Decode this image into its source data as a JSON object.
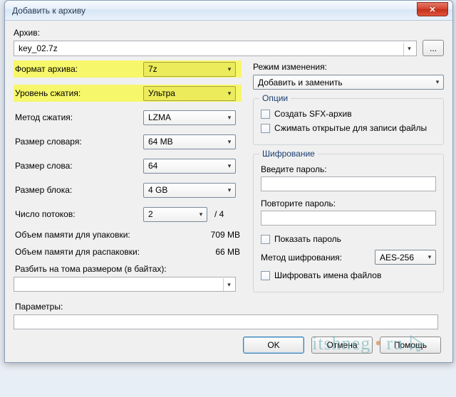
{
  "window": {
    "title": "Добавить к архиву"
  },
  "archive": {
    "label": "Архив:",
    "value": "key_02.7z",
    "browse": "..."
  },
  "left": {
    "format": {
      "label": "Формат архива:",
      "value": "7z"
    },
    "level": {
      "label": "Уровень сжатия:",
      "value": "Ультра"
    },
    "method": {
      "label": "Метод сжатия:",
      "value": "LZMA"
    },
    "dict": {
      "label": "Размер словаря:",
      "value": "64 MB"
    },
    "word": {
      "label": "Размер слова:",
      "value": "64"
    },
    "block": {
      "label": "Размер блока:",
      "value": "4 GB"
    },
    "threads": {
      "label": "Число потоков:",
      "value": "2",
      "max": "/ 4"
    },
    "mem_pack": {
      "label": "Объем памяти для упаковки:",
      "value": "709 MB"
    },
    "mem_unpack": {
      "label": "Объем памяти для распаковки:",
      "value": "66 MB"
    },
    "split_label": "Разбить на тома размером (в байтах):",
    "params_label": "Параметры:"
  },
  "right": {
    "mode": {
      "label": "Режим изменения:",
      "value": "Добавить и заменить"
    },
    "options": {
      "legend": "Опции",
      "sfx": "Создать SFX-архив",
      "open_shared": "Сжимать открытые для записи файлы"
    },
    "encryption": {
      "legend": "Шифрование",
      "pw1": "Введите пароль:",
      "pw2": "Повторите пароль:",
      "show_pw": "Показать пароль",
      "method_label": "Метод шифрования:",
      "method_value": "AES-256",
      "encrypt_names": "Шифровать имена файлов"
    }
  },
  "buttons": {
    "ok": "OK",
    "cancel": "Отмена",
    "help": "Помощь"
  },
  "watermark": "itshneg ru"
}
